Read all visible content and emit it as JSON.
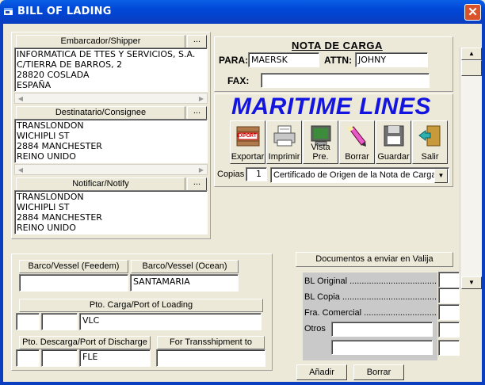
{
  "window": {
    "title": "BILL OF LADING"
  },
  "shipper": {
    "label": "Embarcador/Shipper",
    "dots": "...",
    "text": "INFORMATICA DE TTES Y SERVICIOS, S.A.\nC/TIERRA DE BARROS, 2\n28820 COSLADA\nESPAÑA"
  },
  "consignee": {
    "label": "Destinatario/Consignee",
    "dots": "...",
    "text": "TRANSLONDON\nWICHIPLI ST\n2884 MANCHESTER\nREINO UNIDO"
  },
  "notify": {
    "label": "Notificar/Notify",
    "dots": "...",
    "text": "TRANSLONDON\nWICHIPLI ST\n2884 MANCHESTER\nREINO UNIDO"
  },
  "nota": {
    "title": "NOTA DE CARGA",
    "para_label": "PARA:",
    "para_value": "MAERSK",
    "attn_label": "ATTN:",
    "attn_value": "JOHNY",
    "fax_label": "FAX:",
    "fax_value": ""
  },
  "brand": {
    "text": "MARITIME LINES",
    "color": "#1414E0"
  },
  "toolbar": {
    "buttons": [
      {
        "label": "Exportar",
        "icon": "export-icon"
      },
      {
        "label": "Imprimir",
        "icon": "printer-icon"
      },
      {
        "label": "Vista Pre.",
        "icon": "monitor-icon"
      },
      {
        "label": "Borrar",
        "icon": "pencil-eraser-icon"
      },
      {
        "label": "Guardar",
        "icon": "floppy-disk-icon"
      },
      {
        "label": "Salir",
        "icon": "exit-door-icon"
      }
    ],
    "export_badge": "EXPORT"
  },
  "copies": {
    "label": "Copias",
    "value": "1",
    "doc_select": "Certificado de Origen de la Nota de Carga"
  },
  "vessels": {
    "feeder_label": "Barco/Vessel (Feedem)",
    "feeder_value": "",
    "ocean_label": "Barco/Vessel (Ocean)",
    "ocean_value": "SANTAMARIA",
    "pol_label": "Pto. Carga/Port of Loading",
    "pol_value": "VLC",
    "pod_label": "Pto. Descarga/Port of Discharge",
    "pod_value": "FLE",
    "transship_label": "For Transshipment to",
    "transship_value": ""
  },
  "docs": {
    "title": "Documentos a enviar en Valija",
    "rows": [
      {
        "label": "BL Original .............................................."
      },
      {
        "label": "BL Copia ................................................."
      },
      {
        "label": "Fra. Comercial ..........................................."
      }
    ],
    "otros_label": "Otros",
    "add_button": "Añadir",
    "delete_button": "Borrar"
  }
}
